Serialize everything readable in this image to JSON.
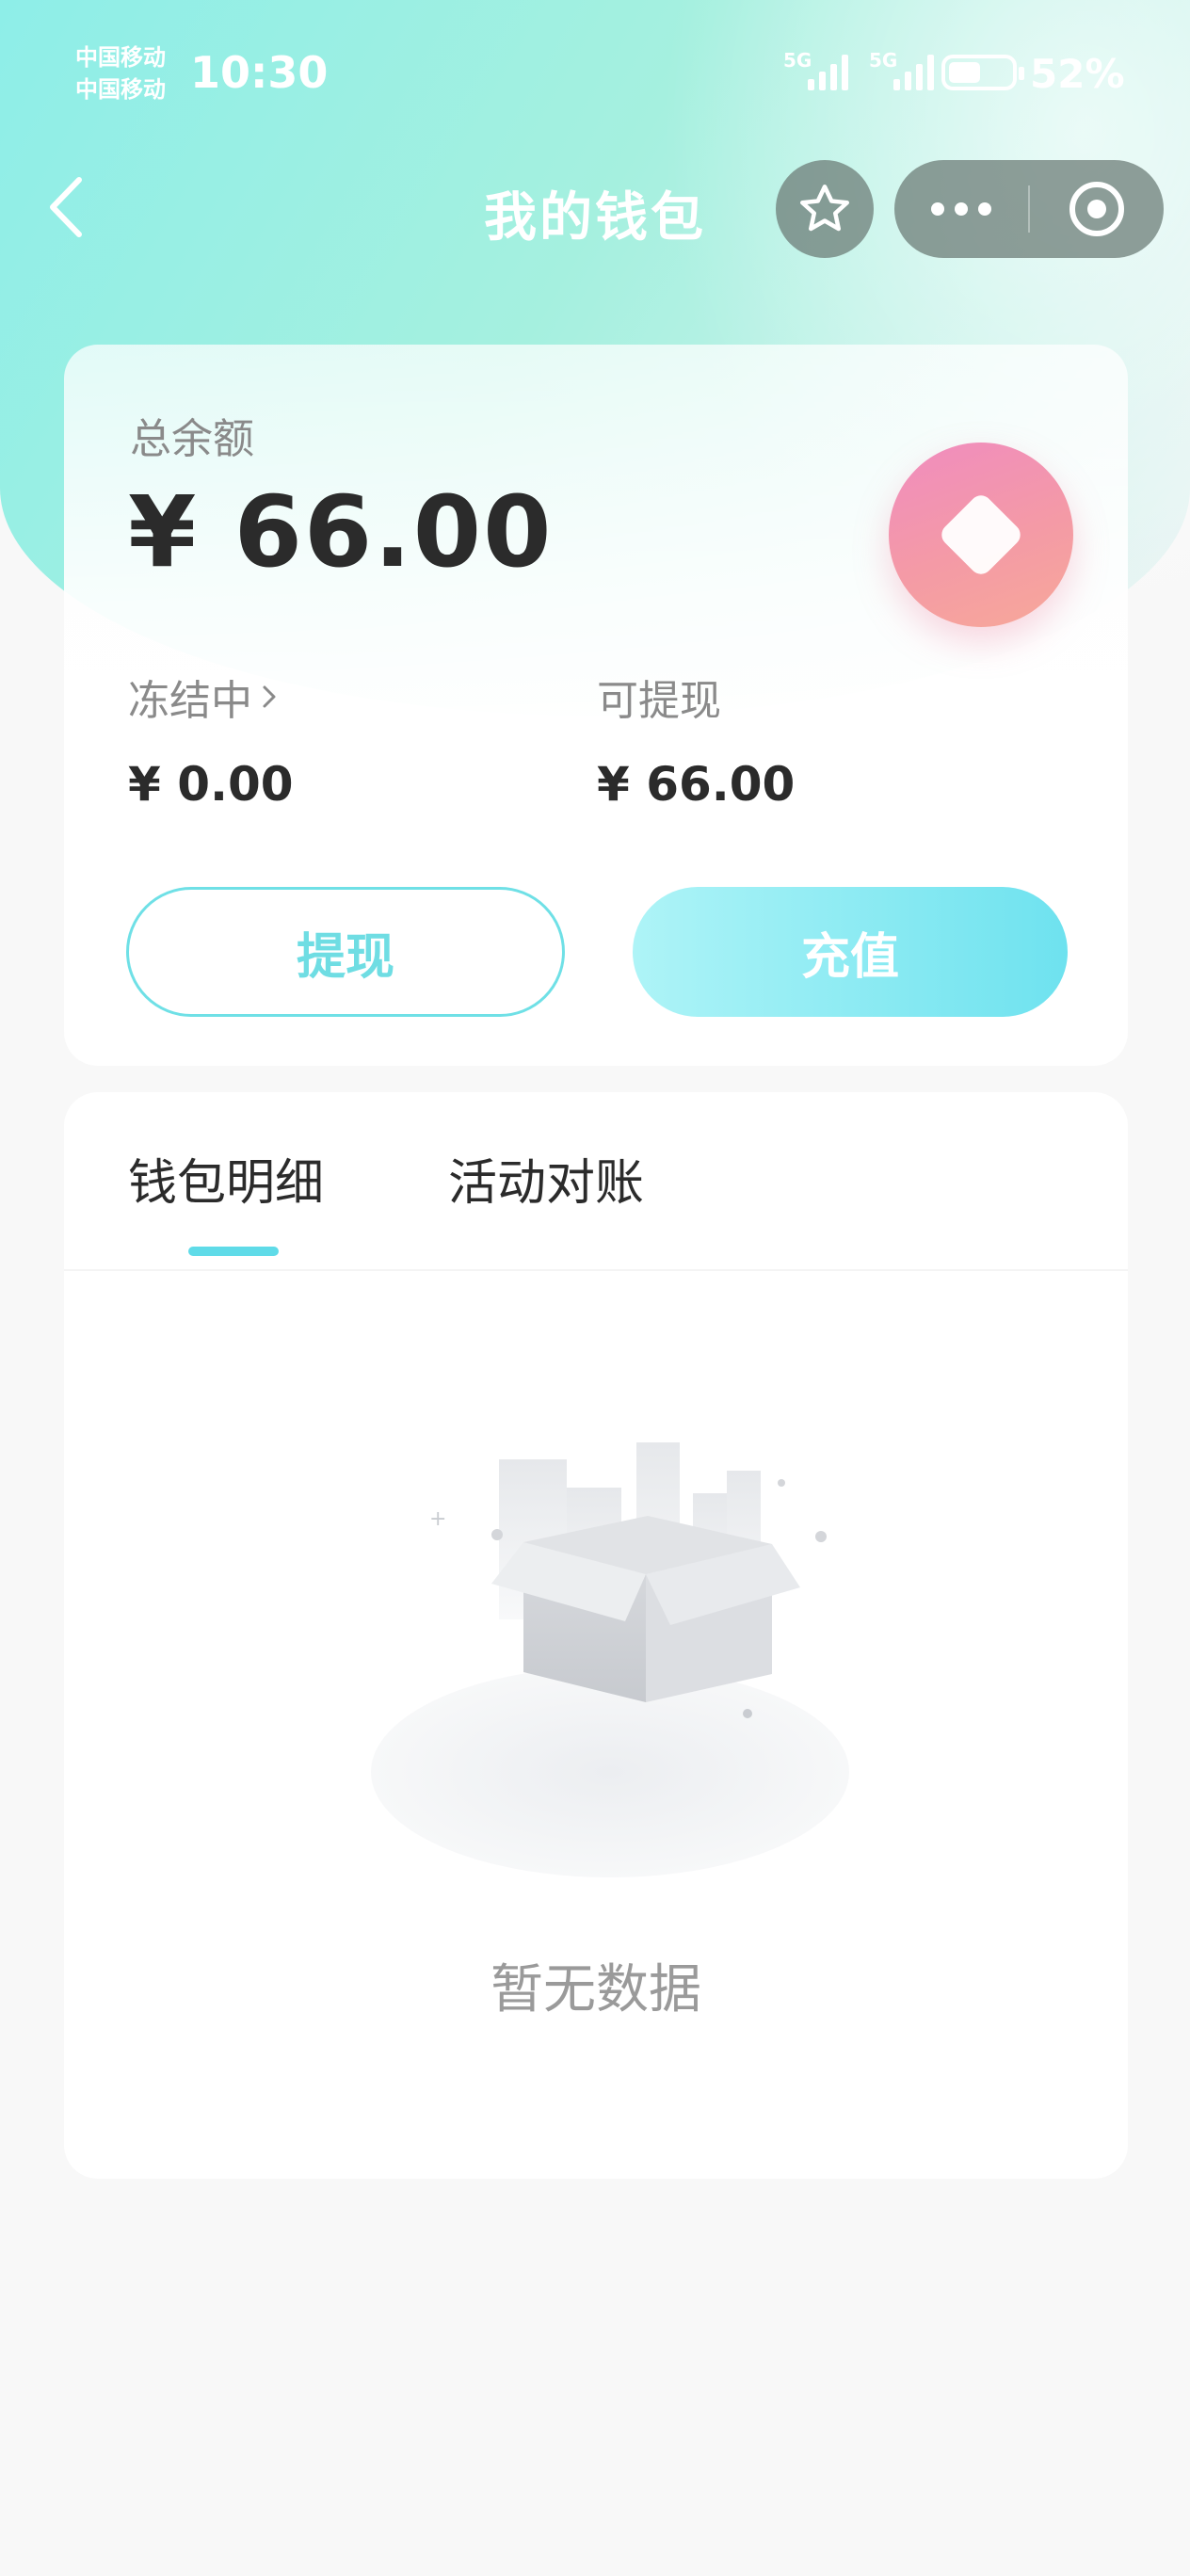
{
  "status_bar": {
    "carrier_1": "中国移动",
    "carrier_2": "中国移动",
    "time": "10:30",
    "network_1": "5G",
    "network_2": "5G",
    "battery_percent": "52%",
    "battery_level": 0.52
  },
  "nav": {
    "title": "我的钱包",
    "back_icon": "chevron-left-icon",
    "favorite_icon": "star-icon",
    "more_icon": "more-dots-icon",
    "close_icon": "target-icon"
  },
  "balance": {
    "total_label": "总余额",
    "total_amount": "¥ 66.00",
    "frozen_label": "冻结中",
    "frozen_amount": "¥ 0.00",
    "withdrawable_label": "可提现",
    "withdrawable_amount": "¥ 66.00",
    "withdraw_button": "提现",
    "recharge_button": "充值",
    "coin_icon": "diamond-coin-icon"
  },
  "detail": {
    "tabs": [
      {
        "label": "钱包明细",
        "active": true
      },
      {
        "label": "活动对账",
        "active": false
      }
    ],
    "empty_icon": "empty-box-icon",
    "empty_text": "暂无数据"
  },
  "colors": {
    "accent": "#6fdde3",
    "coin": "#f394ad",
    "hero_start": "#8eeee8"
  }
}
